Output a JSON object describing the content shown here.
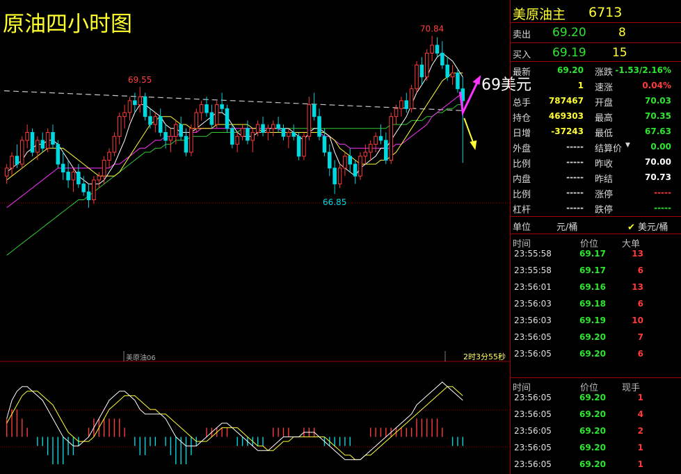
{
  "chart_title": "原油四小时图",
  "annotation_text": "69美元",
  "contract_label": "美原油06",
  "countdown": "2时3分55秒",
  "colors": {
    "up": "#ff3b3b",
    "down": "#00d8e0",
    "ma5": "#ffffff",
    "ma10": "#ffff33",
    "ma20": "#ff33ff",
    "ma60": "#33cc33",
    "dash": "#c8c8c8",
    "grid": "#a00000"
  },
  "chart_data": {
    "type": "candlestick",
    "price_range": [
      63.5,
      71.6
    ],
    "macd_range": [
      -0.6,
      1.5
    ],
    "labels": {
      "high_label": "70.84",
      "left_high_label": "69.55",
      "low_label": "66.85"
    },
    "candles": [
      [
        67.3,
        67.6,
        67.1,
        67.5
      ],
      [
        67.5,
        67.9,
        67.3,
        67.8
      ],
      [
        67.8,
        68.1,
        67.5,
        67.6
      ],
      [
        67.6,
        68.3,
        67.5,
        68.2
      ],
      [
        68.2,
        68.6,
        68.0,
        68.4
      ],
      [
        68.4,
        68.5,
        67.8,
        67.9
      ],
      [
        67.9,
        68.3,
        67.7,
        68.2
      ],
      [
        68.2,
        68.4,
        67.9,
        68.0
      ],
      [
        68.0,
        68.5,
        67.9,
        68.4
      ],
      [
        68.4,
        68.6,
        68.0,
        68.1
      ],
      [
        68.1,
        68.2,
        67.5,
        67.6
      ],
      [
        67.6,
        67.9,
        67.2,
        67.4
      ],
      [
        67.4,
        67.7,
        67.0,
        67.2
      ],
      [
        67.2,
        67.5,
        66.9,
        67.4
      ],
      [
        67.4,
        67.6,
        67.0,
        67.1
      ],
      [
        67.1,
        67.3,
        66.8,
        66.9
      ],
      [
        66.9,
        67.1,
        66.5,
        66.7
      ],
      [
        66.7,
        67.3,
        66.6,
        67.2
      ],
      [
        67.2,
        67.4,
        67.0,
        67.3
      ],
      [
        67.3,
        67.8,
        67.1,
        67.7
      ],
      [
        67.7,
        68.0,
        67.5,
        67.9
      ],
      [
        67.9,
        68.4,
        67.8,
        68.3
      ],
      [
        68.3,
        68.9,
        68.1,
        68.8
      ],
      [
        68.8,
        69.1,
        68.5,
        68.9
      ],
      [
        68.9,
        69.3,
        68.7,
        69.2
      ],
      [
        69.2,
        69.4,
        68.9,
        69.1
      ],
      [
        69.1,
        69.55,
        68.9,
        69.3
      ],
      [
        69.3,
        69.4,
        68.7,
        68.8
      ],
      [
        68.8,
        69.0,
        68.5,
        68.6
      ],
      [
        68.6,
        68.9,
        68.4,
        68.8
      ],
      [
        68.8,
        69.0,
        68.3,
        68.4
      ],
      [
        68.4,
        68.6,
        68.0,
        68.2
      ],
      [
        68.2,
        68.5,
        67.9,
        68.3
      ],
      [
        68.3,
        68.7,
        68.1,
        68.6
      ],
      [
        68.6,
        68.8,
        68.2,
        68.3
      ],
      [
        68.3,
        68.5,
        67.8,
        67.9
      ],
      [
        67.9,
        68.6,
        67.8,
        68.5
      ],
      [
        68.5,
        69.0,
        68.4,
        68.9
      ],
      [
        68.9,
        69.2,
        68.7,
        69.1
      ],
      [
        69.1,
        69.3,
        68.8,
        68.9
      ],
      [
        68.9,
        69.1,
        68.5,
        68.6
      ],
      [
        68.6,
        69.2,
        68.5,
        69.1
      ],
      [
        69.1,
        69.4,
        68.9,
        69.0
      ],
      [
        69.0,
        69.1,
        68.4,
        68.5
      ],
      [
        68.5,
        68.6,
        68.0,
        68.1
      ],
      [
        68.1,
        68.4,
        67.9,
        68.3
      ],
      [
        68.3,
        68.6,
        68.2,
        68.5
      ],
      [
        68.5,
        68.7,
        68.1,
        68.2
      ],
      [
        68.2,
        68.5,
        67.9,
        68.4
      ],
      [
        68.4,
        68.7,
        68.3,
        68.6
      ],
      [
        68.6,
        68.8,
        68.3,
        68.4
      ],
      [
        68.4,
        68.6,
        68.2,
        68.5
      ],
      [
        68.5,
        68.7,
        68.3,
        68.6
      ],
      [
        68.6,
        68.8,
        68.4,
        68.5
      ],
      [
        68.5,
        68.6,
        68.2,
        68.3
      ],
      [
        68.3,
        68.5,
        68.0,
        68.4
      ],
      [
        68.4,
        68.6,
        68.2,
        68.3
      ],
      [
        68.3,
        68.4,
        67.7,
        67.8
      ],
      [
        67.8,
        68.4,
        67.7,
        68.3
      ],
      [
        68.3,
        69.3,
        68.2,
        69.1
      ],
      [
        69.1,
        69.4,
        68.7,
        68.8
      ],
      [
        68.8,
        69.0,
        68.2,
        68.3
      ],
      [
        68.3,
        68.5,
        67.8,
        67.9
      ],
      [
        67.9,
        68.1,
        67.3,
        67.5
      ],
      [
        67.5,
        67.7,
        66.85,
        67.1
      ],
      [
        67.1,
        67.6,
        67.0,
        67.5
      ],
      [
        67.5,
        67.9,
        67.3,
        67.8
      ],
      [
        67.8,
        68.0,
        67.4,
        67.6
      ],
      [
        67.6,
        67.7,
        67.1,
        67.3
      ],
      [
        67.3,
        67.9,
        67.2,
        67.8
      ],
      [
        67.8,
        68.1,
        67.6,
        67.9
      ],
      [
        67.9,
        68.2,
        67.7,
        68.1
      ],
      [
        68.1,
        68.4,
        67.9,
        68.3
      ],
      [
        68.3,
        68.6,
        68.1,
        68.2
      ],
      [
        68.2,
        68.4,
        67.6,
        67.7
      ],
      [
        67.7,
        68.9,
        67.6,
        68.8
      ],
      [
        68.8,
        69.1,
        68.6,
        69.0
      ],
      [
        69.0,
        69.3,
        68.8,
        69.2
      ],
      [
        69.2,
        69.4,
        68.9,
        69.0
      ],
      [
        69.0,
        69.6,
        68.9,
        69.5
      ],
      [
        69.5,
        70.2,
        69.4,
        70.1
      ],
      [
        70.1,
        70.3,
        69.6,
        69.8
      ],
      [
        69.8,
        70.5,
        69.7,
        70.4
      ],
      [
        70.4,
        70.84,
        70.2,
        70.6
      ],
      [
        70.6,
        70.8,
        70.3,
        70.4
      ],
      [
        70.4,
        70.7,
        70.0,
        70.1
      ],
      [
        70.1,
        70.3,
        69.7,
        69.8
      ],
      [
        69.8,
        70.1,
        69.6,
        69.9
      ],
      [
        69.9,
        70.0,
        69.4,
        69.5
      ],
      [
        69.5,
        69.8,
        67.63,
        69.2
      ]
    ],
    "ma5": [
      67.4,
      67.5,
      67.6,
      67.7,
      67.9,
      68.0,
      68.1,
      68.1,
      68.2,
      68.2,
      68.1,
      67.9,
      67.7,
      67.5,
      67.3,
      67.2,
      67.1,
      67.1,
      67.1,
      67.2,
      67.4,
      67.6,
      67.9,
      68.2,
      68.6,
      68.9,
      69.1,
      69.1,
      69.0,
      68.9,
      68.8,
      68.6,
      68.5,
      68.5,
      68.4,
      68.4,
      68.4,
      68.5,
      68.6,
      68.7,
      68.8,
      68.9,
      68.9,
      68.8,
      68.6,
      68.4,
      68.3,
      68.3,
      68.3,
      68.4,
      68.4,
      68.5,
      68.5,
      68.5,
      68.5,
      68.5,
      68.4,
      68.3,
      68.2,
      68.4,
      68.5,
      68.5,
      68.4,
      68.3,
      67.9,
      67.6,
      67.5,
      67.4,
      67.3,
      67.5,
      67.6,
      67.7,
      67.8,
      68.0,
      68.0,
      68.2,
      68.4,
      68.6,
      68.8,
      69.1,
      69.4,
      69.6,
      69.8,
      70.1,
      70.3,
      70.4,
      70.3,
      70.2,
      70.0,
      69.8
    ],
    "ma10": [
      67.2,
      67.3,
      67.4,
      67.5,
      67.6,
      67.7,
      67.8,
      67.9,
      68.0,
      68.0,
      68.0,
      68.0,
      67.9,
      67.8,
      67.7,
      67.6,
      67.5,
      67.4,
      67.3,
      67.3,
      67.3,
      67.3,
      67.4,
      67.6,
      67.8,
      68.0,
      68.2,
      68.4,
      68.6,
      68.7,
      68.8,
      68.8,
      68.8,
      68.7,
      68.6,
      68.6,
      68.5,
      68.5,
      68.5,
      68.5,
      68.5,
      68.6,
      68.6,
      68.6,
      68.6,
      68.6,
      68.6,
      68.6,
      68.5,
      68.5,
      68.4,
      68.4,
      68.4,
      68.4,
      68.4,
      68.4,
      68.4,
      68.4,
      68.4,
      68.4,
      68.4,
      68.4,
      68.4,
      68.3,
      68.2,
      68.0,
      67.9,
      67.8,
      67.7,
      67.6,
      67.6,
      67.6,
      67.6,
      67.7,
      67.7,
      67.8,
      67.9,
      68.1,
      68.3,
      68.5,
      68.7,
      68.9,
      69.1,
      69.3,
      69.5,
      69.7,
      69.8,
      69.9,
      69.9,
      69.9
    ],
    "ma20": [
      66.5,
      66.6,
      66.7,
      66.8,
      66.9,
      67.0,
      67.1,
      67.2,
      67.3,
      67.4,
      67.5,
      67.5,
      67.5,
      67.5,
      67.5,
      67.5,
      67.5,
      67.5,
      67.5,
      67.5,
      67.5,
      67.6,
      67.6,
      67.7,
      67.8,
      67.9,
      68.0,
      68.0,
      68.1,
      68.2,
      68.2,
      68.3,
      68.3,
      68.3,
      68.4,
      68.4,
      68.4,
      68.4,
      68.5,
      68.5,
      68.5,
      68.5,
      68.5,
      68.5,
      68.5,
      68.5,
      68.5,
      68.5,
      68.5,
      68.5,
      68.5,
      68.5,
      68.5,
      68.5,
      68.4,
      68.4,
      68.4,
      68.4,
      68.4,
      68.4,
      68.4,
      68.4,
      68.3,
      68.3,
      68.2,
      68.1,
      68.1,
      68.0,
      68.0,
      68.0,
      68.0,
      68.0,
      68.0,
      68.0,
      68.0,
      68.0,
      68.1,
      68.1,
      68.2,
      68.3,
      68.4,
      68.5,
      68.6,
      68.8,
      68.9,
      69.0,
      69.1,
      69.2,
      69.3,
      69.4
    ],
    "ma60": [
      65.3,
      65.4,
      65.5,
      65.6,
      65.7,
      65.8,
      65.9,
      66.0,
      66.1,
      66.2,
      66.3,
      66.4,
      66.5,
      66.6,
      66.7,
      66.7,
      66.8,
      66.9,
      67.0,
      67.1,
      67.2,
      67.3,
      67.4,
      67.5,
      67.6,
      67.7,
      67.8,
      67.9,
      67.9,
      68.0,
      68.0,
      68.1,
      68.1,
      68.2,
      68.2,
      68.2,
      68.3,
      68.3,
      68.3,
      68.3,
      68.4,
      68.4,
      68.4,
      68.4,
      68.4,
      68.4,
      68.5,
      68.5,
      68.5,
      68.5,
      68.5,
      68.5,
      68.5,
      68.5,
      68.5,
      68.5,
      68.5,
      68.5,
      68.5,
      68.5,
      68.5,
      68.5,
      68.5,
      68.5,
      68.5,
      68.5,
      68.5,
      68.5,
      68.5,
      68.5,
      68.5,
      68.5,
      68.5,
      68.5,
      68.5,
      68.6,
      68.6,
      68.6,
      68.6,
      68.7,
      68.7,
      68.7,
      68.8,
      68.8,
      68.9,
      68.9,
      69.0,
      69.0,
      69.1,
      69.1
    ],
    "macd_dif": [
      0.4,
      0.8,
      1.0,
      1.1,
      1.1,
      1.0,
      0.9,
      0.8,
      0.6,
      0.4,
      0.2,
      0.0,
      -0.1,
      -0.2,
      -0.2,
      -0.1,
      0.0,
      0.2,
      0.4,
      0.6,
      0.8,
      0.9,
      1.0,
      1.0,
      0.9,
      0.8,
      0.6,
      0.5,
      0.5,
      0.5,
      0.5,
      0.4,
      0.2,
      0.0,
      -0.1,
      -0.2,
      -0.2,
      -0.2,
      -0.1,
      0.0,
      0.1,
      0.2,
      0.3,
      0.3,
      0.2,
      0.1,
      0.0,
      -0.1,
      -0.2,
      -0.3,
      -0.3,
      -0.3,
      -0.2,
      -0.1,
      0.0,
      0.0,
      0.0,
      0.0,
      0.1,
      0.1,
      0.1,
      0.0,
      -0.1,
      -0.2,
      -0.3,
      -0.4,
      -0.5,
      -0.5,
      -0.5,
      -0.5,
      -0.4,
      -0.3,
      -0.2,
      -0.1,
      0.0,
      0.1,
      0.2,
      0.3,
      0.4,
      0.5,
      0.7,
      0.8,
      0.9,
      1.0,
      1.1,
      1.2,
      1.1,
      1.0,
      0.9,
      0.8
    ],
    "macd_dea": [
      0.3,
      0.5,
      0.7,
      0.9,
      1.0,
      1.0,
      1.0,
      0.9,
      0.8,
      0.7,
      0.5,
      0.3,
      0.1,
      0.0,
      -0.1,
      -0.1,
      -0.1,
      0.0,
      0.2,
      0.4,
      0.6,
      0.7,
      0.8,
      0.9,
      0.9,
      0.9,
      0.8,
      0.7,
      0.6,
      0.6,
      0.5,
      0.5,
      0.4,
      0.3,
      0.2,
      0.1,
      0.0,
      -0.1,
      -0.1,
      -0.1,
      0.0,
      0.1,
      0.2,
      0.2,
      0.2,
      0.2,
      0.1,
      0.0,
      -0.1,
      -0.2,
      -0.2,
      -0.3,
      -0.3,
      -0.2,
      -0.1,
      -0.1,
      0.0,
      0.0,
      0.0,
      0.0,
      0.0,
      0.0,
      0.0,
      -0.1,
      -0.2,
      -0.3,
      -0.4,
      -0.4,
      -0.5,
      -0.5,
      -0.4,
      -0.4,
      -0.3,
      -0.2,
      -0.1,
      0.0,
      0.1,
      0.2,
      0.3,
      0.4,
      0.5,
      0.6,
      0.7,
      0.8,
      0.9,
      1.0,
      1.1,
      1.1,
      1.0,
      0.9
    ],
    "macd_hist": [
      0.4,
      0.6,
      0.6,
      0.4,
      0.2,
      0.0,
      -0.2,
      -0.2,
      -0.4,
      -0.6,
      -0.6,
      -0.6,
      -0.4,
      -0.4,
      -0.2,
      0.0,
      0.2,
      0.4,
      0.4,
      0.4,
      0.4,
      0.4,
      0.4,
      0.2,
      0.0,
      -0.2,
      -0.4,
      -0.4,
      -0.2,
      -0.2,
      0.0,
      -0.2,
      -0.4,
      -0.6,
      -0.6,
      -0.6,
      -0.4,
      -0.2,
      0.0,
      0.2,
      0.2,
      0.2,
      0.2,
      0.2,
      0.0,
      -0.2,
      -0.2,
      -0.2,
      -0.2,
      -0.2,
      -0.2,
      0.0,
      0.2,
      0.2,
      0.2,
      0.2,
      0.0,
      0.0,
      0.2,
      0.2,
      0.2,
      0.0,
      -0.2,
      -0.2,
      -0.2,
      -0.2,
      -0.2,
      -0.2,
      0.0,
      0.0,
      0.0,
      0.2,
      0.2,
      0.2,
      0.2,
      0.2,
      0.2,
      0.2,
      0.2,
      0.2,
      0.4,
      0.4,
      0.4,
      0.4,
      0.4,
      0.2,
      0.0,
      -0.2,
      -0.2,
      -0.2
    ]
  },
  "quote": {
    "name": "美原油主",
    "code": "6713",
    "sell_label": "卖出",
    "sell_price": "69.20",
    "sell_qty": "8",
    "buy_label": "买入",
    "buy_price": "69.19",
    "buy_qty": "15",
    "rows": [
      {
        "l1": "最新",
        "v1": "69.20",
        "c1": "g",
        "l2": "涨跌",
        "v2": "-1.53/2.16%",
        "c2": "g"
      },
      {
        "l1": "",
        "v1": "1",
        "c1": "y",
        "l2": "速涨",
        "v2": "0.04%",
        "c2": "r"
      },
      {
        "l1": "总手",
        "v1": "787467",
        "c1": "y",
        "l2": "开盘",
        "v2": "70.03",
        "c2": "g"
      },
      {
        "l1": "持仓",
        "v1": "469303",
        "c1": "y",
        "l2": "最高",
        "v2": "70.35",
        "c2": "g"
      },
      {
        "l1": "日增",
        "v1": "-37243",
        "c1": "y",
        "l2": "最低",
        "v2": "67.63",
        "c2": "g"
      },
      {
        "l1": "外盘",
        "v1": "-----",
        "c1": "lbl",
        "l2": "结算价",
        "v2": "0.00",
        "c2": "g"
      },
      {
        "l1": "比例",
        "v1": "-----",
        "c1": "lbl",
        "l2": "昨收",
        "v2": "70.00",
        "c2": "w"
      },
      {
        "l1": "内盘",
        "v1": "-----",
        "c1": "lbl",
        "l2": "昨结",
        "v2": "70.73",
        "c2": "w"
      },
      {
        "l1": "比例",
        "v1": "-----",
        "c1": "lbl",
        "l2": "涨停",
        "v2": "-----",
        "c2": "r"
      },
      {
        "l1": "杠杆",
        "v1": "-----",
        "c1": "lbl",
        "l2": "跌停",
        "v2": "-----",
        "c2": "g"
      }
    ],
    "unit_label": "单位",
    "unit_value": "元/桶",
    "unit_option": "美元/桶"
  },
  "trades_top": {
    "headers": [
      "时间",
      "价位",
      "大单"
    ],
    "rows": [
      [
        "23:55:58",
        "69.17",
        "13"
      ],
      [
        "23:55:58",
        "69.17",
        "6"
      ],
      [
        "23:56:01",
        "69.16",
        "13"
      ],
      [
        "23:56:03",
        "69.18",
        "6"
      ],
      [
        "23:56:03",
        "69.19",
        "10"
      ],
      [
        "23:56:05",
        "69.20",
        "7"
      ],
      [
        "23:56:05",
        "69.20",
        "6"
      ]
    ]
  },
  "trades_bottom": {
    "headers": [
      "时间",
      "价位",
      "现手"
    ],
    "rows": [
      [
        "23:56:05",
        "69.20",
        "1"
      ],
      [
        "23:56:05",
        "69.20",
        "4"
      ],
      [
        "23:56:05",
        "69.20",
        "2"
      ],
      [
        "23:56:05",
        "69.20",
        "1"
      ],
      [
        "23:56:05",
        "69.20",
        "1"
      ]
    ]
  }
}
